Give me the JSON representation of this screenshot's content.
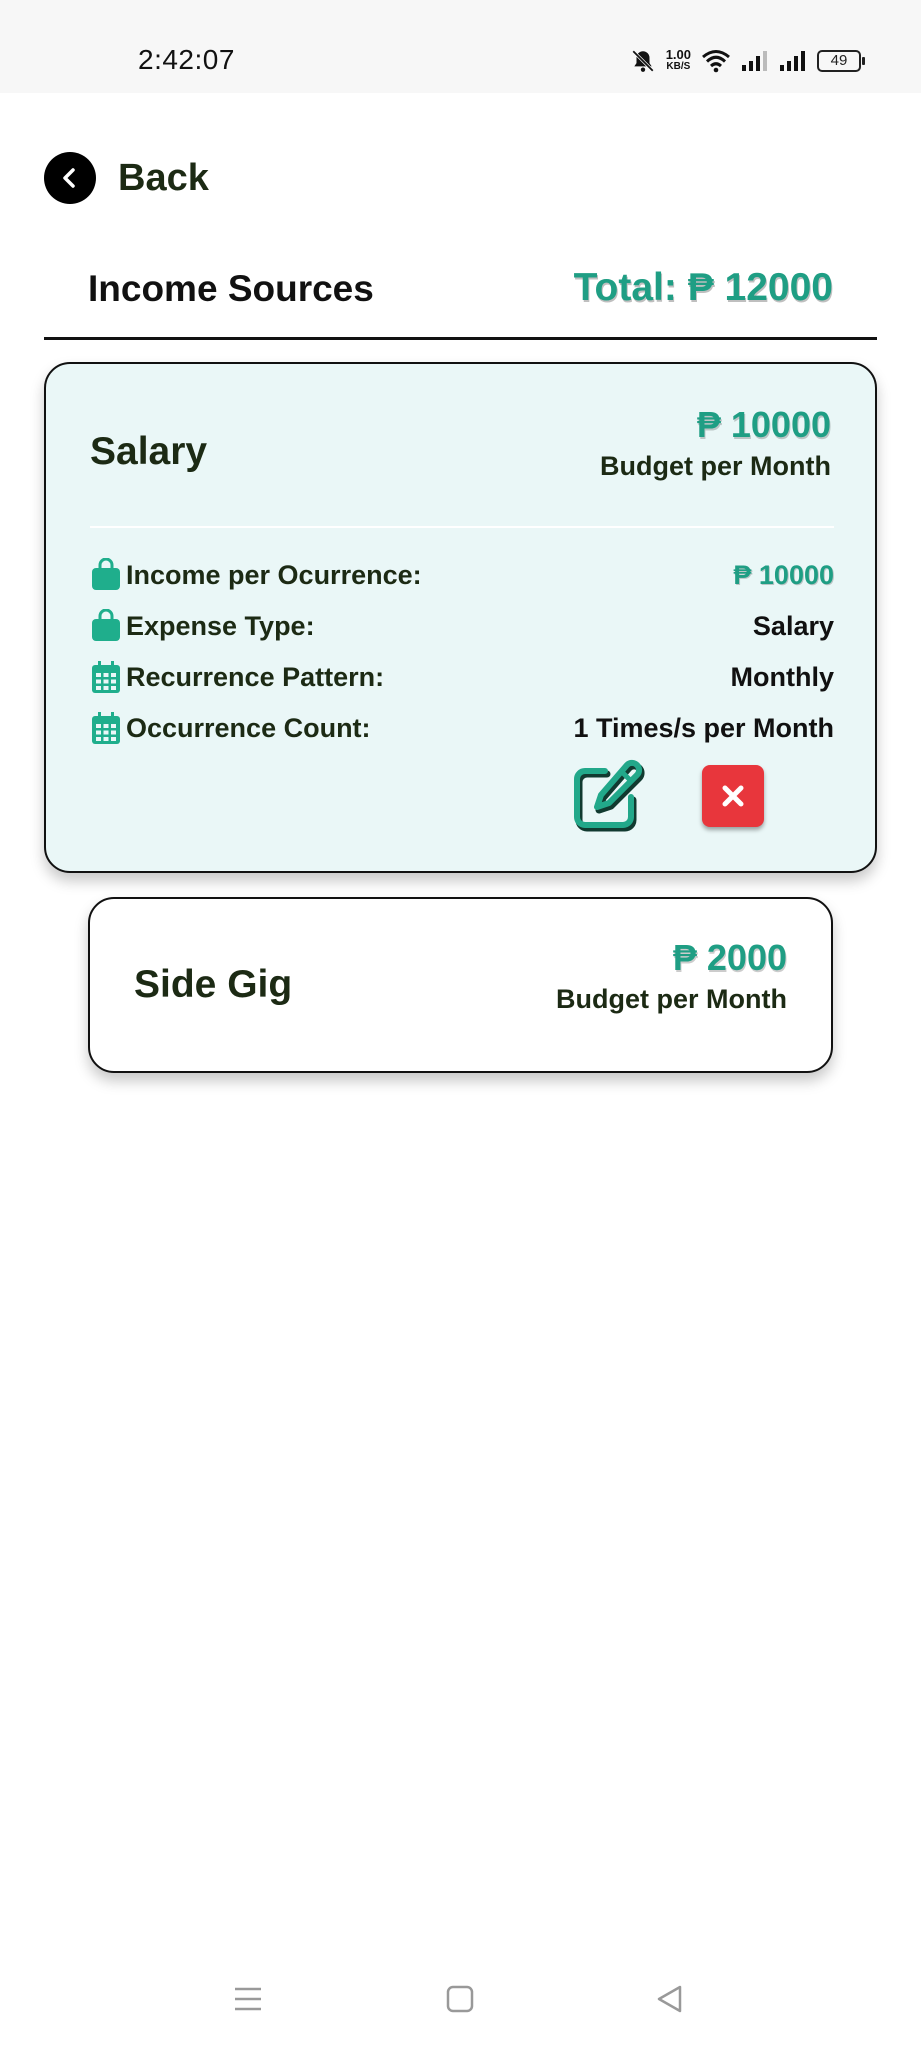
{
  "status_bar": {
    "time": "2:42:07",
    "net_speed_value": "1.00",
    "net_speed_unit": "KB/S",
    "battery": "49"
  },
  "nav": {
    "back_label": "Back"
  },
  "header": {
    "title": "Income Sources",
    "total": "Total: ₱ 12000"
  },
  "colors": {
    "accent": "#1f9e84",
    "card_bg": "#eaf7f7",
    "delete": "#e8363c"
  },
  "cards": [
    {
      "name": "Salary",
      "amount": "₱ 10000",
      "subtitle": "Budget per Month",
      "expanded": true,
      "details": [
        {
          "icon": "bag-icon",
          "label": "Income per Ocurrence:",
          "value": "₱ 10000"
        },
        {
          "icon": "bag-icon",
          "label": "Expense Type:",
          "value": "Salary"
        },
        {
          "icon": "calendar-icon",
          "label": "Recurrence Pattern:",
          "value": "Monthly"
        },
        {
          "icon": "calendar-icon",
          "label": "Occurrence Count:",
          "value": "1 Times/s per Month"
        }
      ]
    },
    {
      "name": "Side Gig",
      "amount": "₱ 2000",
      "subtitle": "Budget per Month",
      "expanded": false
    }
  ]
}
